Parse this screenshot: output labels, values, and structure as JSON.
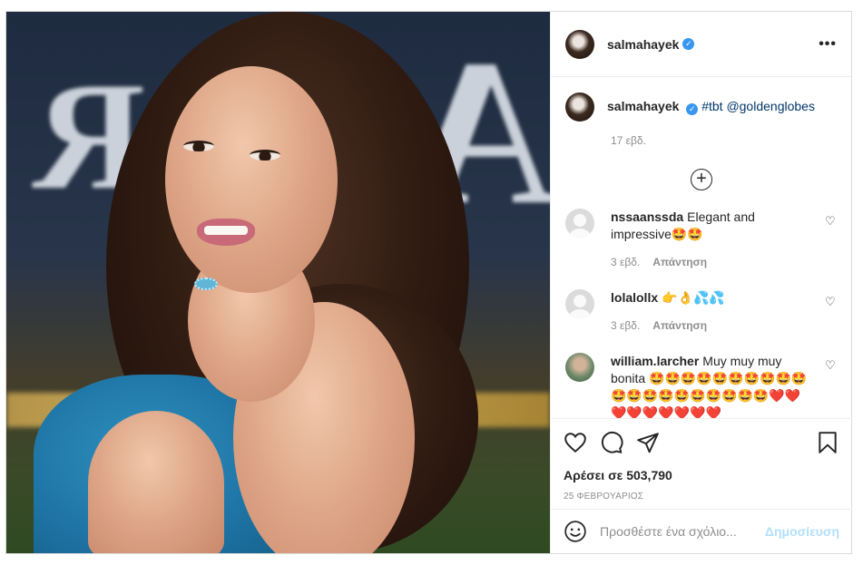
{
  "post": {
    "author": "salmahayek",
    "verified_mark": "✓",
    "more_label": "•••",
    "caption": {
      "username": "salmahayek",
      "hashtag": "#tbt",
      "mention": "@goldenglobes",
      "time": "17 εβδ."
    },
    "load_more": "+",
    "comments": [
      {
        "username": "nssaanssda",
        "text": "Elegant and impressive🤩🤩",
        "time": "3 εβδ.",
        "reply": "Απάντηση"
      },
      {
        "username": "lolalollx",
        "text": "👉👌💦💦",
        "time": "3 εβδ.",
        "reply": "Απάντηση"
      },
      {
        "username": "william.larcher",
        "text": "Muy muy muy bonita 🤩🤩🤩🤩🤩🤩🤩🤩🤩🤩🤩🤩🤩🤩🤩🤩🤩🤩🤩🤩❤️❤️❤️❤️❤️❤️❤️❤️❤️",
        "time": "",
        "reply": ""
      }
    ],
    "likes": "Αρέσει σε 503,790",
    "date": "25 ΦΕΒΡΟΥΑΡΙΟΣ",
    "add_comment_placeholder": "Προσθέστε ένα σχόλιο...",
    "post_button": "Δημοσίευση",
    "icons": {
      "like": "heart-icon",
      "comment": "comment-icon",
      "share": "paper-plane-icon",
      "save": "bookmark-icon",
      "emoji": "smiley-icon"
    },
    "colors": {
      "accent_blue": "#3897f0",
      "post_button_disabled": "#b2dffc",
      "link": "#00376b",
      "dress": "#1f76a6"
    }
  }
}
